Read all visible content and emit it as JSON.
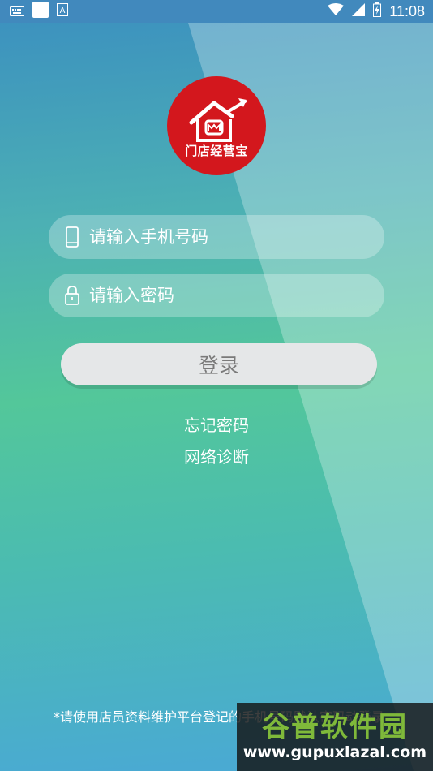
{
  "status_bar": {
    "time": "11:08",
    "icons": [
      "keyboard-icon",
      "app-square-icon",
      "notification-a-icon",
      "wifi-icon",
      "signal-icon",
      "battery-charging-icon"
    ]
  },
  "logo": {
    "text": "门店经营宝",
    "icon": "house-growth-arrow-icon",
    "color": "#d3171d"
  },
  "form": {
    "phone_placeholder": "请输入手机号码",
    "password_placeholder": "请输入密码",
    "phone_icon": "phone-icon",
    "password_icon": "lock-icon",
    "login_label": "登录"
  },
  "links": {
    "forgot_password": "忘记密码",
    "network_diagnosis": "网络诊断"
  },
  "notice": "*请使用店员资料维护平台登记的手机号码默认密码动登录",
  "watermark": {
    "name": "谷普软件园",
    "url": "www.gupuxlazal.com"
  },
  "colors": {
    "status_bar": "#4189bd",
    "button_bg": "#e5e7e8",
    "button_text": "#7a7a7a",
    "watermark_green": "#7fb93a"
  }
}
